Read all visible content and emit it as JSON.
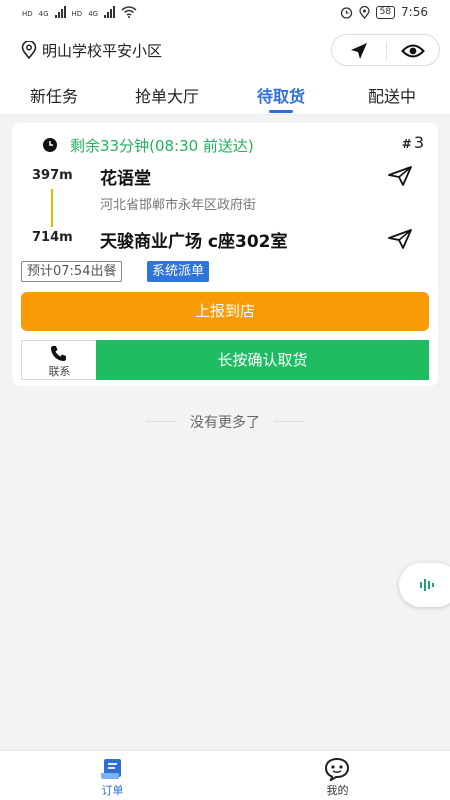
{
  "status_bar": {
    "left_signals": [
      "HD",
      "4G",
      "HD",
      "4G"
    ],
    "battery": "58",
    "time": "7:56",
    "icons": [
      "alarm-icon",
      "location-icon",
      "battery-icon",
      "wifi-icon"
    ]
  },
  "header": {
    "location": "明山学校平安小区",
    "icons": [
      "location-pin-icon",
      "navigation-arrow-icon",
      "eye-icon"
    ]
  },
  "tabs": [
    {
      "label": "新任务"
    },
    {
      "label": "抢单大厅"
    },
    {
      "label": "待取货",
      "active": true
    },
    {
      "label": "配送中"
    }
  ],
  "order": {
    "remaining": "剩余33分钟(08:30 前送达)",
    "number_prefix": "#",
    "number": "3",
    "pickup": {
      "distance": "397m",
      "name": "花语堂",
      "address": "河北省邯郸市永年区政府街"
    },
    "dropoff": {
      "distance": "714m",
      "name": "天骏商业广场 c座302室"
    },
    "eta_tag": "预计07:54出餐",
    "dispatch_tag": "系统派单",
    "report_button": "上报到店",
    "contact_label": "联系",
    "confirm_button": "长按确认取货"
  },
  "list_footer": "没有更多了",
  "bottom_nav": [
    {
      "label": "订单",
      "icon": "orders-icon",
      "active": true
    },
    {
      "label": "我的",
      "icon": "profile-icon",
      "active": false
    }
  ],
  "colors": {
    "primary_blue": "#2f6fd6",
    "remaining_green": "#23b25c",
    "report_orange": "#f99a07",
    "confirm_green": "#1fbc62",
    "route_yellow": "#f0b400"
  }
}
